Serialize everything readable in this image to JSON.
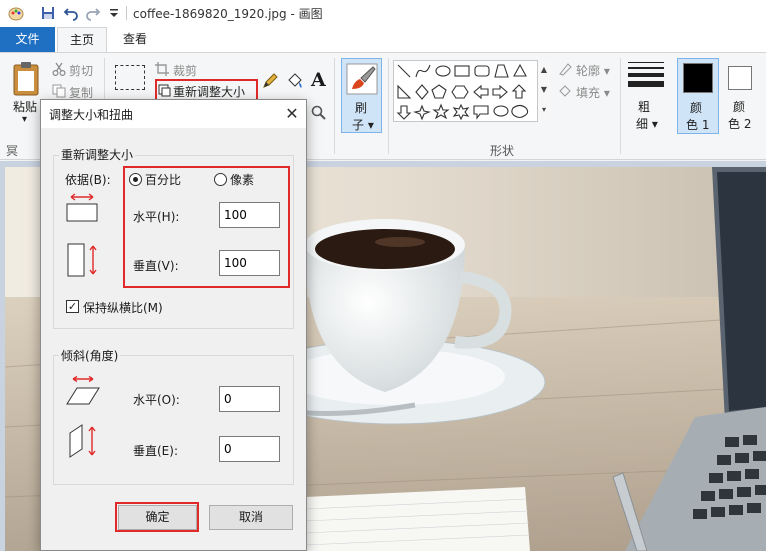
{
  "window": {
    "title": "coffee-1869820_1920.jpg - 画图"
  },
  "tabs": {
    "file": "文件",
    "home": "主页",
    "view": "查看"
  },
  "ribbon": {
    "paste": "粘贴",
    "paste_arrow": "▾",
    "cut": "剪切",
    "copy": "复制",
    "crop": "裁剪",
    "resize": "重新调整大小",
    "image_group_short": "冥",
    "brush_top": "刷",
    "brush_bottom": "子",
    "outline": "轮廓",
    "fill": "填充",
    "shapes_label": "形状",
    "size_top": "粗",
    "size_bottom": "细",
    "color1_top": "颜",
    "color1_bottom": "色 1",
    "color2_top": "颜",
    "color2_bottom": "色 2",
    "color1_value": "#000000",
    "color2_value": "#ffffff"
  },
  "dialog": {
    "title": "调整大小和扭曲",
    "resize_section": "重新调整大小",
    "by_label": "依据(B):",
    "percent": "百分比",
    "pixels": "像素",
    "selected_mode": "percent",
    "horizontal_label": "水平(H):",
    "horizontal_value": "100",
    "vertical_label": "垂直(V):",
    "vertical_value": "100",
    "maintain_ratio": "保持纵横比(M)",
    "maintain_ratio_checked": true,
    "skew_section": "倾斜(角度)",
    "skew_h_label": "水平(O):",
    "skew_h_value": "0",
    "skew_v_label": "垂直(E):",
    "skew_v_value": "0",
    "ok": "确定",
    "cancel": "取消"
  },
  "colors": {
    "accent": "#1f6fc2",
    "highlight": "#e02a2a"
  }
}
